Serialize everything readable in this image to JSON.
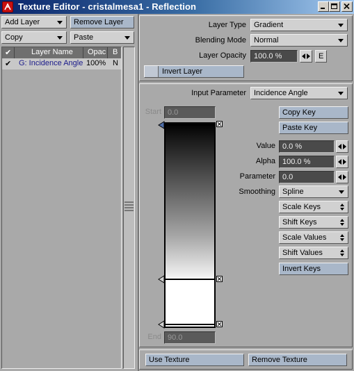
{
  "window": {
    "title": "Texture Editor - cristalmesa1 - Reflection"
  },
  "left": {
    "add_layer": "Add Layer",
    "remove_layer": "Remove Layer",
    "copy": "Copy",
    "paste": "Paste",
    "columns": {
      "check": "✔",
      "name": "Layer Name",
      "opac": "Opac",
      "b": "B"
    },
    "rows": [
      {
        "check": "✔",
        "name": "G: Incidence Angle",
        "opac": "100%",
        "b": "N"
      }
    ]
  },
  "layer": {
    "type_label": "Layer Type",
    "type_value": "Gradient",
    "blend_label": "Blending Mode",
    "blend_value": "Normal",
    "opacity_label": "Layer Opacity",
    "opacity_value": "100.0 %",
    "envelope": "E",
    "invert": "Invert Layer"
  },
  "gradient": {
    "input_label": "Input Parameter",
    "input_value": "Incidence Angle",
    "start_label": "Start",
    "start_value": "0.0",
    "end_label": "End",
    "end_value": "90.0",
    "copy_key": "Copy Key",
    "paste_key": "Paste Key",
    "value_label": "Value",
    "value_value": "0.0 %",
    "alpha_label": "Alpha",
    "alpha_value": "100.0 %",
    "parameter_label": "Parameter",
    "parameter_value": "0.0",
    "smoothing_label": "Smoothing",
    "smoothing_value": "Spline",
    "scale_keys": "Scale Keys",
    "shift_keys": "Shift Keys",
    "scale_values": "Scale Values",
    "shift_values": "Shift Values",
    "invert_keys": "Invert Keys",
    "keys": [
      {
        "parameter": 0.0,
        "value": "0%"
      },
      {
        "parameter": 69.3,
        "value": "100%"
      },
      {
        "parameter": 90.0,
        "value": "100%"
      }
    ]
  },
  "bottom": {
    "use_texture": "Use Texture",
    "remove_texture": "Remove Texture"
  },
  "colors": {
    "title_bar": "#0a246a",
    "panel": "#a9a9a9",
    "blue_button": "#a9b7c9",
    "field": "#4a4a4a"
  }
}
